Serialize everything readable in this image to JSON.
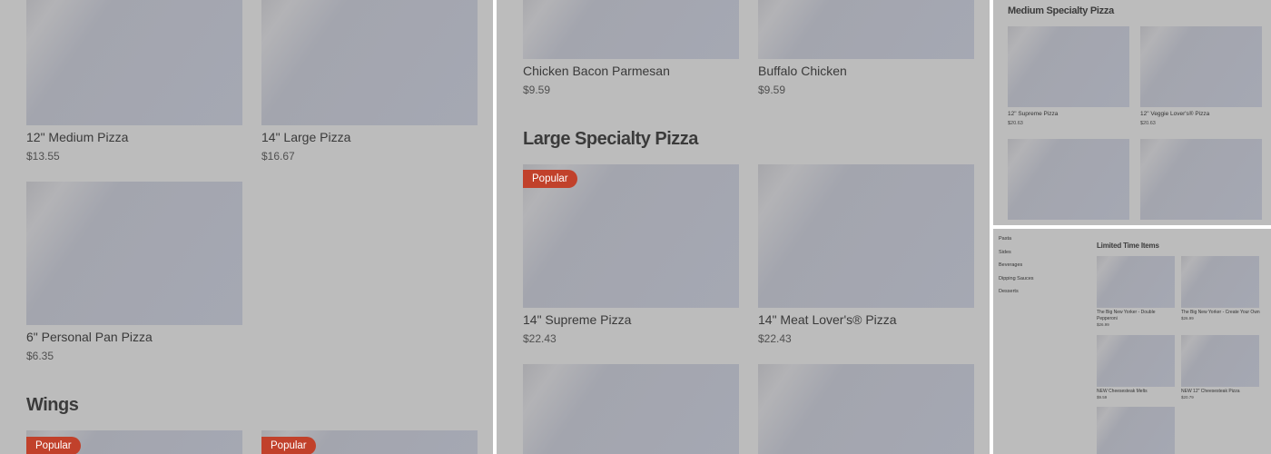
{
  "panel1": {
    "items": [
      {
        "name": "12\" Medium Pizza",
        "price": "$13.55"
      },
      {
        "name": "14\" Large Pizza",
        "price": "$16.67"
      },
      {
        "name": "6\" Personal Pan Pizza",
        "price": "$6.35"
      }
    ],
    "section_title": "Wings",
    "badges": [
      "Popular",
      "Popular"
    ]
  },
  "panel2": {
    "items_top": [
      {
        "name": "Chicken Bacon Parmesan",
        "price": "$9.59"
      },
      {
        "name": "Buffalo Chicken",
        "price": "$9.59"
      }
    ],
    "section_title": "Large Specialty Pizza",
    "badge": "Popular",
    "items": [
      {
        "name": "14\" Supreme Pizza",
        "price": "$22.43"
      },
      {
        "name": "14\" Meat Lover's® Pizza",
        "price": "$22.43"
      }
    ]
  },
  "panel3": {
    "section_title": "Medium Specialty Pizza",
    "items": [
      {
        "name": "12\" Supreme Pizza",
        "price": "$20.63"
      },
      {
        "name": "12\" Veggie Lover's® Pizza",
        "price": "$20.63"
      }
    ]
  },
  "panel4": {
    "sidebar": [
      "Pasta",
      "Sides",
      "Beverages",
      "Dipping Sauces",
      "Desserts"
    ],
    "section_title": "Limited Time Items",
    "items": [
      {
        "name": "The Big New Yorker - Double Pepperoni",
        "price": "$26.99"
      },
      {
        "name": "The Big New Yorker - Create Your Own",
        "price": "$26.99"
      },
      {
        "name": "NEW Cheesesteak Melts",
        "price": "$9.59"
      },
      {
        "name": "NEW 12\" Cheesesteak Pizza",
        "price": "$20.79"
      }
    ]
  }
}
